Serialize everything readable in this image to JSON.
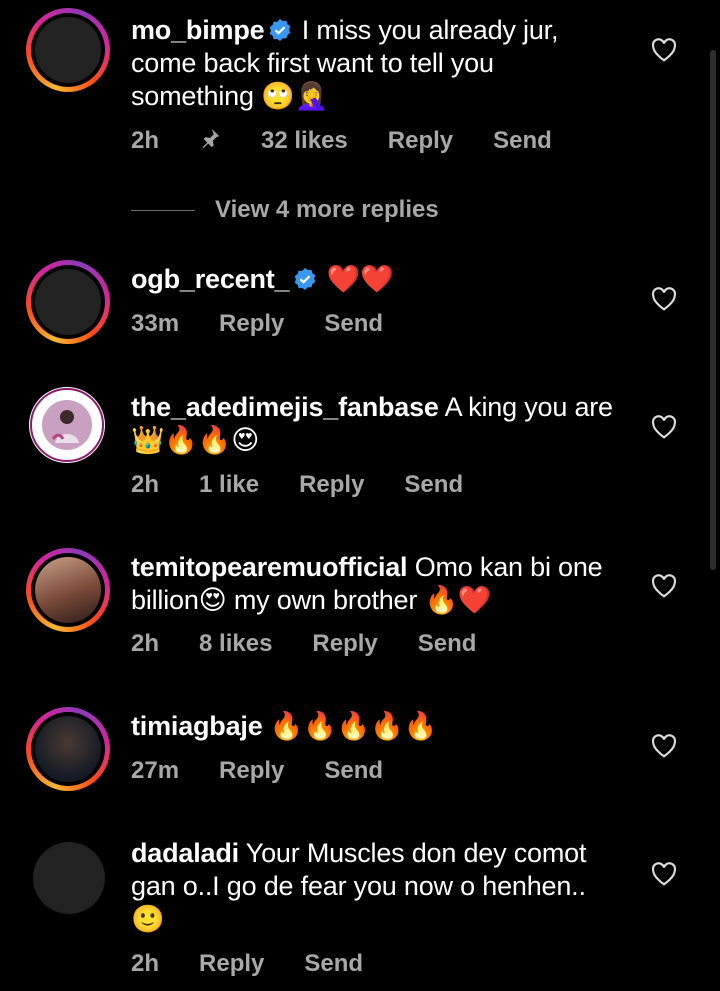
{
  "comments": [
    {
      "username": "mo_bimpe",
      "verified": true,
      "text": "I miss you already jur, come back first want to tell you something 🙄🤦‍♀️",
      "time": "2h",
      "pinned": true,
      "likes": "32 likes",
      "reply": "Reply",
      "send": "Send"
    },
    {
      "username": "ogb_recent_",
      "verified": true,
      "text": "❤️❤️",
      "time": "33m",
      "likes": "",
      "reply": "Reply",
      "send": "Send"
    },
    {
      "username": "the_adedimejis_fanbase",
      "verified": false,
      "text": "A king you are 👑🔥🔥😍",
      "time": "2h",
      "likes": "1 like",
      "reply": "Reply",
      "send": "Send"
    },
    {
      "username": "temitopearemuofficial",
      "verified": false,
      "text": "Omo kan bi one billion😍 my own brother 🔥❤️",
      "time": "2h",
      "likes": "8 likes",
      "reply": "Reply",
      "send": "Send"
    },
    {
      "username": "timiagbaje",
      "verified": false,
      "text": "🔥🔥🔥🔥🔥",
      "time": "27m",
      "likes": "",
      "reply": "Reply",
      "send": "Send"
    },
    {
      "username": "dadaladi",
      "verified": false,
      "text": "Your Muscles don dey comot gan o..I go de fear you now o henhen.. 🙂",
      "time": "2h",
      "likes": "",
      "reply": "Reply",
      "send": "Send"
    }
  ],
  "view_replies": "View 4 more replies",
  "colors": {
    "background": "#000000",
    "meta": "#a8a8a8",
    "verified": "#3897f0"
  }
}
